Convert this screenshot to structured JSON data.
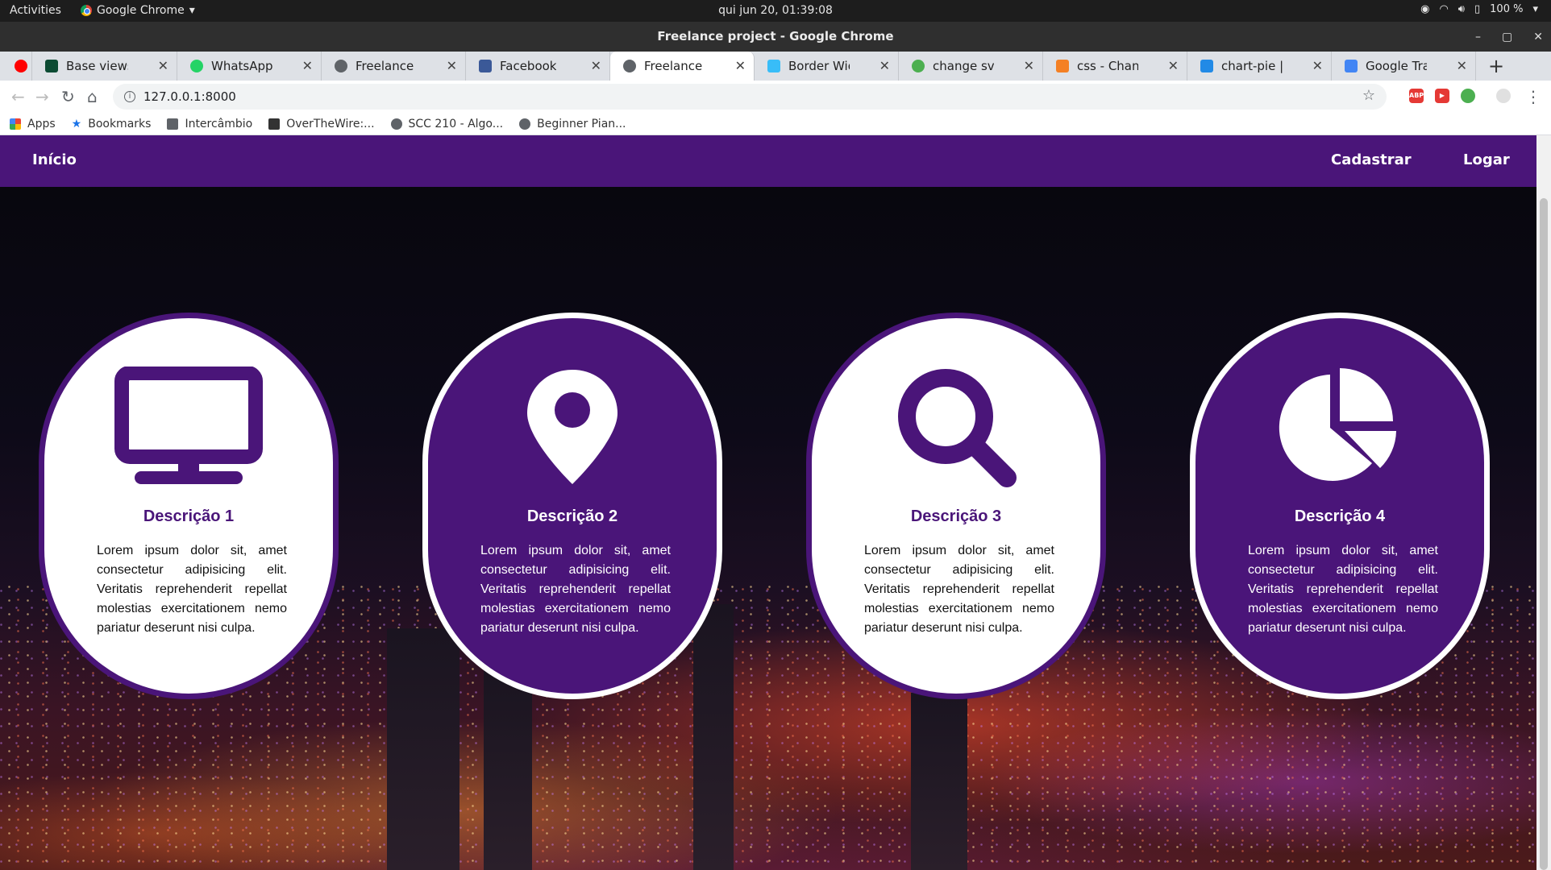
{
  "os": {
    "activities": "Activities",
    "app_name": "Google Chrome",
    "clock": "qui jun 20, 01:39:08",
    "battery": "100 %"
  },
  "window": {
    "title": "Freelance project - Google Chrome"
  },
  "tabs": [
    {
      "label": "Base views | Djan",
      "color": "#0c4b33"
    },
    {
      "label": "WhatsApp",
      "color": "#25d366"
    },
    {
      "label": "Freelance projec",
      "color": "#5f6368"
    },
    {
      "label": "Facebook",
      "color": "#3b5998"
    },
    {
      "label": "Freelance projec",
      "color": "#5f6368",
      "active": true
    },
    {
      "label": "Border Width - Ta",
      "color": "#38bdf8"
    },
    {
      "label": "change svg color",
      "color": "#4caf50"
    },
    {
      "label": "css - Change svg",
      "color": "#f48024"
    },
    {
      "label": "chart-pie | Font A",
      "color": "#228ae6"
    },
    {
      "label": "Google Tradutor",
      "color": "#4285f4"
    }
  ],
  "address": {
    "url": "127.0.0.1:8000"
  },
  "bookmarks": [
    {
      "label": "Apps",
      "color": "#ea4335"
    },
    {
      "label": "Bookmarks",
      "color": "#1a73e8"
    },
    {
      "label": "Intercâmbio",
      "color": "#5f6368"
    },
    {
      "label": "OverTheWire:...",
      "color": "#333333"
    },
    {
      "label": "SCC 210 - Algo...",
      "color": "#5f6368"
    },
    {
      "label": "Beginner Pian...",
      "color": "#5f6368"
    }
  ],
  "site": {
    "nav": {
      "home": "Início",
      "register": "Cadastrar",
      "login": "Logar"
    },
    "cards": [
      {
        "icon": "desktop-icon",
        "title": "Descrição 1",
        "text": "Lorem ipsum dolor sit, amet consectetur adipisicing elit. Veritatis reprehenderit repellat molestias exercitationem nemo pariatur deserunt nisi culpa."
      },
      {
        "icon": "map-marker-icon",
        "title": "Descrição 2",
        "text": "Lorem ipsum dolor sit, amet consectetur adipisicing elit. Veritatis reprehenderit repellat molestias exercitationem nemo pariatur deserunt nisi culpa."
      },
      {
        "icon": "search-icon",
        "title": "Descrição 3",
        "text": "Lorem ipsum dolor sit, amet consectetur adipisicing elit. Veritatis reprehenderit repellat molestias exercitationem nemo pariatur deserunt nisi culpa."
      },
      {
        "icon": "chart-pie-icon",
        "title": "Descrição 4",
        "text": "Lorem ipsum dolor sit, amet consectetur adipisicing elit. Veritatis reprehenderit repellat molestias exercitationem nemo pariatur deserunt nisi culpa."
      }
    ],
    "colors": {
      "brand_purple": "#4a1579",
      "white": "#ffffff"
    }
  }
}
